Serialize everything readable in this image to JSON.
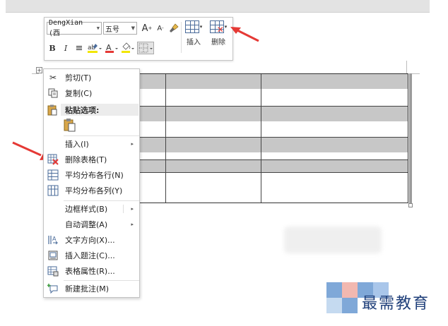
{
  "mini_toolbar": {
    "font_name": "DengXian (西",
    "font_size": "五号",
    "grow_font": "A",
    "shrink_font": "A",
    "bold": "B",
    "italic": "I",
    "font_color_letter": "A",
    "insert_label": "插入",
    "delete_label": "删除"
  },
  "context_menu": {
    "items": [
      {
        "label": "剪切(T)",
        "icon": "scissors-icon"
      },
      {
        "label": "复制(C)",
        "icon": "copy-icon"
      },
      {
        "label": "粘贴选项:",
        "icon": "paste-icon"
      },
      {
        "label": "插入(I)",
        "icon": "",
        "submenu": "▸"
      },
      {
        "label": "删除表格(T)",
        "icon": "delete-table-icon"
      },
      {
        "label": "平均分布各行(N)",
        "icon": "distribute-rows-icon"
      },
      {
        "label": "平均分布各列(Y)",
        "icon": "distribute-columns-icon"
      },
      {
        "label": "边框样式(B)",
        "icon": "",
        "submenu": "▸"
      },
      {
        "label": "自动调整(A)",
        "icon": "",
        "submenu": "▸"
      },
      {
        "label": "文字方向(X)...",
        "icon": "text-direction-icon"
      },
      {
        "label": "插入题注(C)...",
        "icon": "insert-caption-icon"
      },
      {
        "label": "表格属性(R)...",
        "icon": "table-properties-icon"
      },
      {
        "label": "新建批注(M)",
        "icon": "new-comment-icon"
      }
    ]
  },
  "table": {
    "rows": 5,
    "columns": 3
  },
  "watermark": {
    "text": "最需教育"
  },
  "colors": {
    "arrow": "#e53935",
    "table_shade": "#c7c7c7",
    "watermark_blue": "#1f3f7a"
  }
}
